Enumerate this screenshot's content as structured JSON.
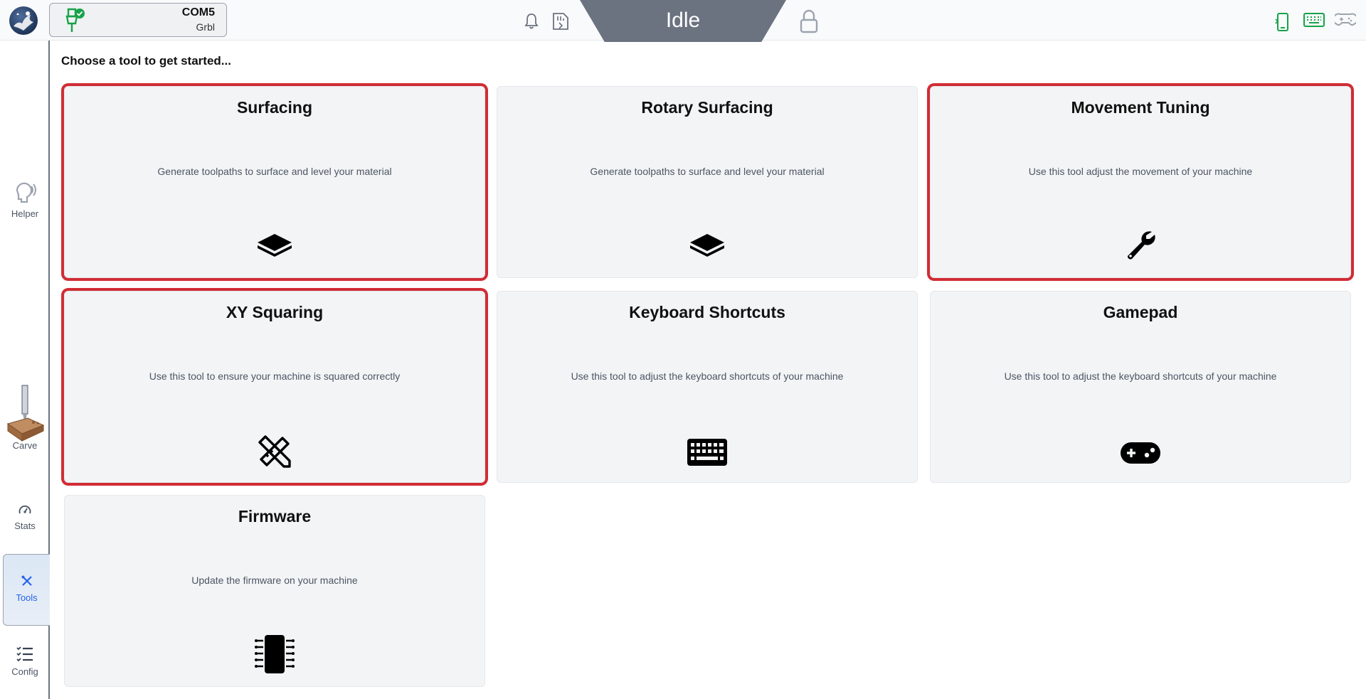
{
  "header": {
    "connection": {
      "port": "COM5",
      "firmware": "Grbl"
    },
    "state": "Idle",
    "icons": [
      "bell-icon",
      "sd-card-icon",
      "lock-icon",
      "mobile-icon",
      "keyboard-icon",
      "gamepad-icon"
    ]
  },
  "sidebar": {
    "items": [
      {
        "label": "Helper",
        "icon": "helper-icon"
      },
      {
        "label": "Carve",
        "icon": "carve-icon"
      },
      {
        "label": "Stats",
        "icon": "gauge-icon"
      },
      {
        "label": "Tools",
        "icon": "tools-icon",
        "active": true
      },
      {
        "label": "Config",
        "icon": "list-icon"
      }
    ]
  },
  "main": {
    "prompt": "Choose a tool to get started...",
    "tools": [
      {
        "title": "Surfacing",
        "description": "Generate toolpaths to surface and level your material",
        "icon": "layer-icon",
        "highlighted": true
      },
      {
        "title": "Rotary Surfacing",
        "description": "Generate toolpaths to surface and level your material",
        "icon": "layer-icon",
        "highlighted": false
      },
      {
        "title": "Movement Tuning",
        "description": "Use this tool adjust the movement of your machine",
        "icon": "wrench-icon",
        "highlighted": true
      },
      {
        "title": "XY Squaring",
        "description": "Use this tool to ensure your machine is squared correctly",
        "icon": "pencil-ruler-icon",
        "highlighted": true
      },
      {
        "title": "Keyboard Shortcuts",
        "description": "Use this tool to adjust the keyboard shortcuts of your machine",
        "icon": "keyboard-icon",
        "highlighted": false
      },
      {
        "title": "Gamepad",
        "description": "Use this tool to adjust the keyboard shortcuts of your machine",
        "icon": "gamepad-icon",
        "highlighted": false
      },
      {
        "title": "Firmware",
        "description": "Update the firmware on your machine",
        "icon": "chip-icon",
        "highlighted": false
      }
    ]
  },
  "colors": {
    "highlight": "#d12c34",
    "accent_green": "#16a34a",
    "state_bg": "#6b7280",
    "active_blue": "#2563eb"
  }
}
